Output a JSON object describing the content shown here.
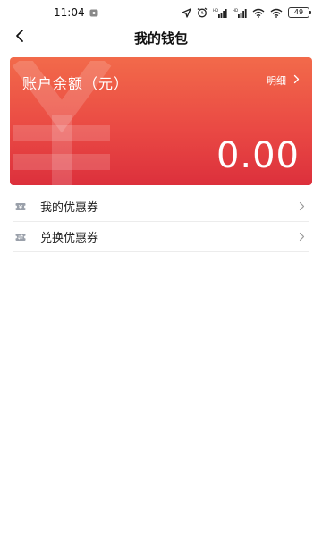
{
  "status_bar": {
    "time": "11:04",
    "battery": "49",
    "icons": [
      "notification-icon",
      "location-arrow-icon",
      "alarm-icon",
      "hd-signal-icon",
      "hd-signal-icon",
      "wifi-icon",
      "wifi-icon",
      "battery-icon"
    ]
  },
  "nav": {
    "title": "我的钱包",
    "back_icon": "chevron-left-icon"
  },
  "wallet": {
    "label": "账户余额（元）",
    "detail_label": "明细",
    "amount": "0.00",
    "watermark_icon": "yen-icon",
    "colors": {
      "top": "#f26a4a",
      "bottom": "#dc303c"
    }
  },
  "menu": [
    {
      "label": "我的优惠券",
      "icon": "coupon-icon"
    },
    {
      "label": "兑换优惠券",
      "icon": "coupon-exchange-icon"
    }
  ]
}
